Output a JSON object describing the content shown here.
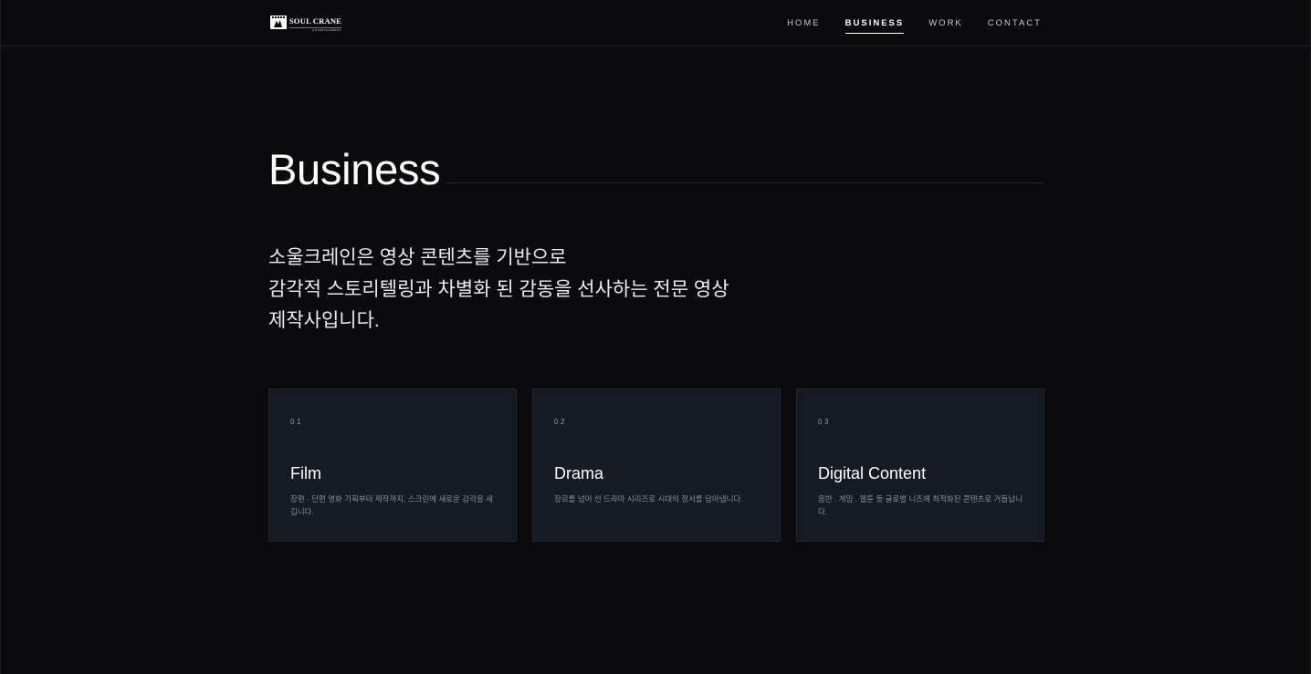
{
  "header": {
    "logo": {
      "name": "SOUL CRANE",
      "sub": "ENTERTAINMENT"
    },
    "nav": [
      {
        "label": "HOME",
        "active": false
      },
      {
        "label": "BUSINESS",
        "active": true
      },
      {
        "label": "WORK",
        "active": false
      },
      {
        "label": "CONTACT",
        "active": false
      }
    ]
  },
  "main": {
    "title": "Business",
    "intro_lines": [
      "소울크레인은 영상 콘텐츠를 기반으로",
      "감각적 스토리텔링과 차별화 된 감동을 선사하는 전문 영상",
      "제작사입니다."
    ],
    "cards": [
      {
        "number": "01",
        "title": "Film",
        "description": "장편 · 단편 영화 기획부터 제작까지, 스크린에 새로운 감각을 새깁니다."
      },
      {
        "number": "02",
        "title": "Drama",
        "description": "장르를 넘어 선 드라마 시리즈로 시대의 정서를 담아냅니다."
      },
      {
        "number": "03",
        "title": "Digital Content",
        "description": "음반 . 게임 . 웹툰 등 글로벌 니즈에 최적화된 콘텐츠로 거듭납니다."
      }
    ]
  },
  "colors": {
    "background": "#0b0b0e",
    "card": "#161a23",
    "text": "#ffffff",
    "muted": "#8b8f99"
  }
}
